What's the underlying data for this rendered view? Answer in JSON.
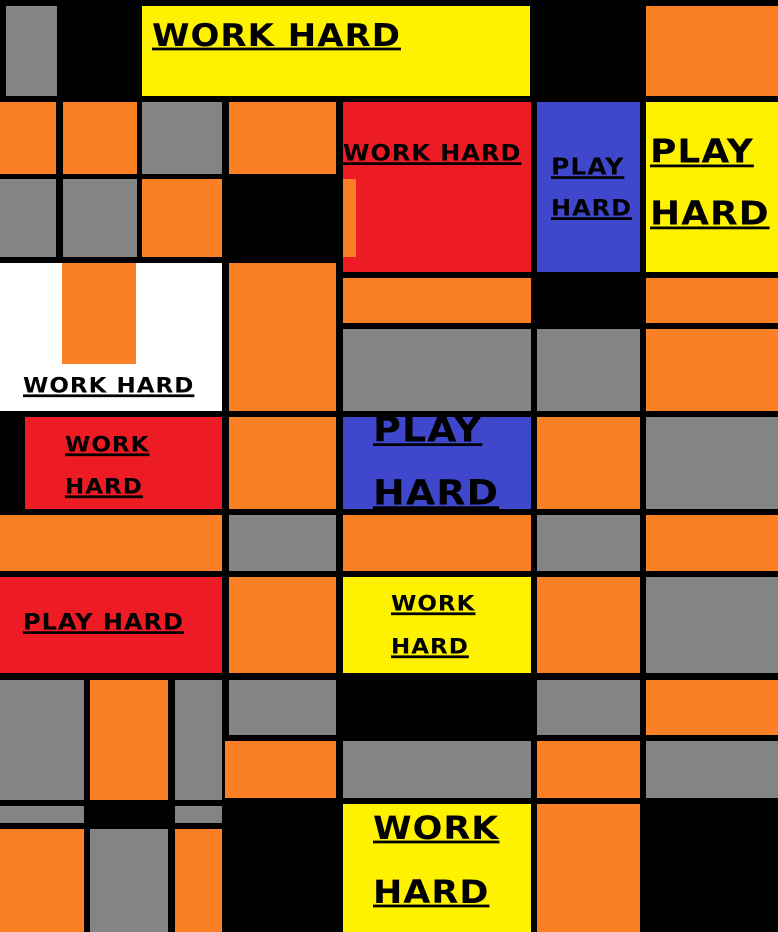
{
  "palette": {
    "orange": "#fb7f24",
    "gray": "#848484",
    "yellow": "#fff200",
    "red": "#ed1b24",
    "blue": "#3f48cc",
    "white": "#ffffff",
    "black": "#000000"
  },
  "labels": {
    "banner_work_hard": "WORK  HARD",
    "red_top_work_hard": "WORK  HARD",
    "blue_top_play": "PLAY",
    "blue_top_hard": "HARD",
    "yellow_right_play": "PLAY",
    "yellow_right_hard": "HARD",
    "white_work_hard": "WORK  HARD",
    "red_left_work": "WORK",
    "red_left_hard": "HARD",
    "blue_mid_play": "PLAY",
    "blue_mid_hard": "HARD",
    "red_play_hard": "PLAY HARD",
    "yellow_mid_work": "WORK",
    "yellow_mid_hard": "HARD",
    "yellow_bottom_work": "WORK",
    "yellow_bottom_hard": "HARD"
  }
}
